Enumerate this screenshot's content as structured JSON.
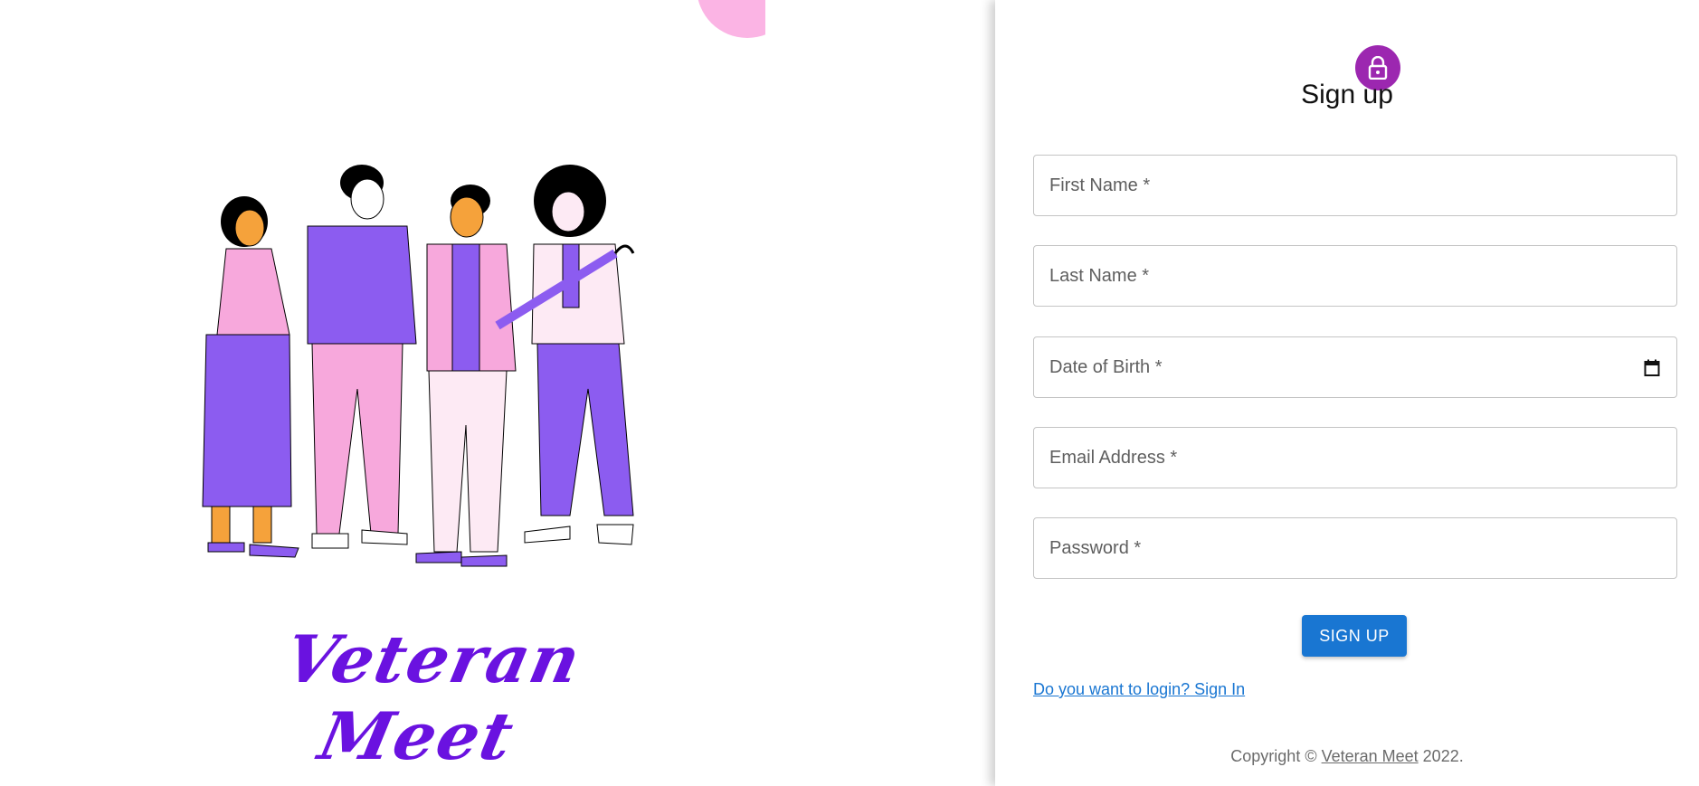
{
  "brand": {
    "name": "Veteran Meet"
  },
  "form": {
    "title": "Sign up",
    "fields": [
      {
        "label": "First Name *"
      },
      {
        "label": "Last Name *"
      },
      {
        "label": "Date of Birth *"
      },
      {
        "label": "Email Address *"
      },
      {
        "label": "Password *"
      }
    ],
    "submit_label": "SIGN UP",
    "signin_link": "Do you want to login? Sign In"
  },
  "footer": {
    "prefix": "Copyright © ",
    "link_text": "Veteran Meet",
    "suffix": " 2022."
  },
  "colors": {
    "accent": "#9c27b0",
    "primary": "#1976d2",
    "brand": "#6a12e0",
    "illustration_purple": "#8c5cf0",
    "illustration_pink": "#f7a8dc",
    "illustration_orange": "#f5a23b"
  },
  "icons": {
    "avatar": "lock-icon",
    "date": "calendar-icon"
  }
}
